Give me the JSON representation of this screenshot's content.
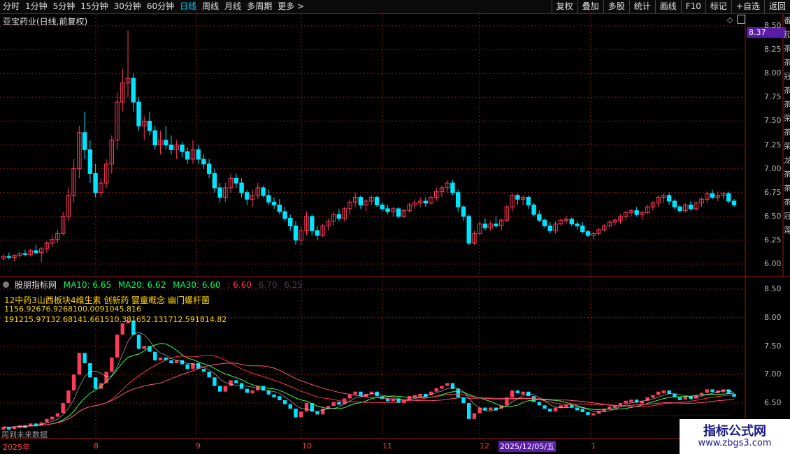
{
  "toolbar": {
    "periods": [
      "分时",
      "1分钟",
      "5分钟",
      "15分钟",
      "30分钟",
      "60分钟",
      "日线",
      "周线",
      "月线",
      "多周期",
      "更多"
    ],
    "active_index": 6,
    "tools": [
      "复权",
      "叠加",
      "多股",
      "统计",
      "画线",
      "F10",
      "标记",
      "+自选",
      "返回"
    ]
  },
  "stock": {
    "title": "亚宝药业(日线,前复权)",
    "last_price": "8.37"
  },
  "indicator": {
    "name": "股朋指标网",
    "ma10": "MA10: 6.65",
    "ma20": "MA20: 6.62",
    "ma30": "MA30: 6.60",
    "extra1": ": 6.60",
    "extra2": "6.70",
    "extra3": "6.25",
    "concepts": "12中药3山西板块4维生素 创新药 婴童概念 幽门螺杆菌",
    "line_a": "1156.92676.9268100.0091045.816",
    "line_b": "191215.97132.68141.661510.381652.131712.591814.82",
    "future_label": "周到未来数据"
  },
  "x_axis": {
    "labels": [
      "2025年",
      "8",
      "9",
      "10",
      "11",
      "12",
      "2025/12/05/五",
      "1"
    ]
  },
  "watermark": {
    "title": "指标公式网",
    "url": "www.zbgs3.com"
  },
  "colors": {
    "up": "#ff3b5c",
    "down": "#00e5ff",
    "ma10": "#ffffff",
    "ma20": "#ffd24a",
    "ma30": "#ff44cc",
    "grid": "#8a1a1a"
  },
  "chart_data": {
    "type": "candlestick",
    "y_axis_top": [
      6.0,
      6.25,
      6.5,
      6.75,
      7.0,
      7.25,
      7.5,
      7.75,
      8.0,
      8.25,
      8.5
    ],
    "y_axis_bottom": [
      6.5,
      7.0,
      7.5,
      8.0,
      8.5
    ],
    "ohlc": [
      [
        6.06,
        6.1,
        6.04,
        6.08
      ],
      [
        6.08,
        6.12,
        6.05,
        6.07
      ],
      [
        6.07,
        6.1,
        6.03,
        6.09
      ],
      [
        6.09,
        6.13,
        6.06,
        6.11
      ],
      [
        6.11,
        6.15,
        6.08,
        6.1
      ],
      [
        6.1,
        6.16,
        6.08,
        6.14
      ],
      [
        6.14,
        6.2,
        6.1,
        6.12
      ],
      [
        6.12,
        6.18,
        6.02,
        6.16
      ],
      [
        6.16,
        6.24,
        6.12,
        6.22
      ],
      [
        6.22,
        6.3,
        6.18,
        6.26
      ],
      [
        6.26,
        6.36,
        6.22,
        6.32
      ],
      [
        6.32,
        6.55,
        6.3,
        6.5
      ],
      [
        6.5,
        6.8,
        6.45,
        6.72
      ],
      [
        6.72,
        7.1,
        6.65,
        7.0
      ],
      [
        7.0,
        7.45,
        6.9,
        7.38
      ],
      [
        7.38,
        7.6,
        7.1,
        7.2
      ],
      [
        7.2,
        7.3,
        6.85,
        6.95
      ],
      [
        6.95,
        7.05,
        6.7,
        6.75
      ],
      [
        6.75,
        6.9,
        6.7,
        6.85
      ],
      [
        6.85,
        7.1,
        6.8,
        7.05
      ],
      [
        7.05,
        7.35,
        6.95,
        7.3
      ],
      [
        7.3,
        7.8,
        7.2,
        7.7
      ],
      [
        7.7,
        8.05,
        7.6,
        7.9
      ],
      [
        7.9,
        8.45,
        7.75,
        7.95
      ],
      [
        7.95,
        8.0,
        7.6,
        7.7
      ],
      [
        7.7,
        7.75,
        7.4,
        7.45
      ],
      [
        7.45,
        7.55,
        7.3,
        7.5
      ],
      [
        7.5,
        7.6,
        7.35,
        7.4
      ],
      [
        7.4,
        7.45,
        7.2,
        7.25
      ],
      [
        7.25,
        7.4,
        7.15,
        7.3
      ],
      [
        7.3,
        7.45,
        7.2,
        7.25
      ],
      [
        7.25,
        7.35,
        7.15,
        7.2
      ],
      [
        7.2,
        7.3,
        7.1,
        7.25
      ],
      [
        7.25,
        7.28,
        7.12,
        7.18
      ],
      [
        7.18,
        7.22,
        7.05,
        7.1
      ],
      [
        7.1,
        7.3,
        7.05,
        7.2
      ],
      [
        7.2,
        7.25,
        7.05,
        7.1
      ],
      [
        7.1,
        7.15,
        7.0,
        7.05
      ],
      [
        7.05,
        7.1,
        6.9,
        6.95
      ],
      [
        6.95,
        7.0,
        6.75,
        6.8
      ],
      [
        6.8,
        6.85,
        6.65,
        6.7
      ],
      [
        6.7,
        6.85,
        6.65,
        6.8
      ],
      [
        6.8,
        6.95,
        6.75,
        6.9
      ],
      [
        6.9,
        6.95,
        6.8,
        6.85
      ],
      [
        6.85,
        6.9,
        6.7,
        6.75
      ],
      [
        6.75,
        6.78,
        6.62,
        6.68
      ],
      [
        6.68,
        6.78,
        6.6,
        6.72
      ],
      [
        6.72,
        6.85,
        6.68,
        6.8
      ],
      [
        6.8,
        6.82,
        6.7,
        6.72
      ],
      [
        6.72,
        6.78,
        6.62,
        6.65
      ],
      [
        6.65,
        6.7,
        6.58,
        6.62
      ],
      [
        6.62,
        6.68,
        6.52,
        6.55
      ],
      [
        6.55,
        6.6,
        6.45,
        6.48
      ],
      [
        6.48,
        6.52,
        6.35,
        6.4
      ],
      [
        6.4,
        6.45,
        6.2,
        6.25
      ],
      [
        6.25,
        6.4,
        6.2,
        6.35
      ],
      [
        6.35,
        6.55,
        6.3,
        6.5
      ],
      [
        6.5,
        6.52,
        6.3,
        6.35
      ],
      [
        6.35,
        6.4,
        6.25,
        6.3
      ],
      [
        6.3,
        6.42,
        6.28,
        6.4
      ],
      [
        6.4,
        6.48,
        6.35,
        6.45
      ],
      [
        6.45,
        6.55,
        6.4,
        6.52
      ],
      [
        6.52,
        6.58,
        6.45,
        6.48
      ],
      [
        6.48,
        6.6,
        6.45,
        6.58
      ],
      [
        6.58,
        6.68,
        6.52,
        6.65
      ],
      [
        6.65,
        6.75,
        6.6,
        6.7
      ],
      [
        6.7,
        6.72,
        6.58,
        6.62
      ],
      [
        6.62,
        6.68,
        6.55,
        6.66
      ],
      [
        6.66,
        6.72,
        6.62,
        6.7
      ],
      [
        6.7,
        6.72,
        6.6,
        6.62
      ],
      [
        6.62,
        6.65,
        6.55,
        6.58
      ],
      [
        6.58,
        6.62,
        6.52,
        6.55
      ],
      [
        6.55,
        6.6,
        6.5,
        6.58
      ],
      [
        6.58,
        6.6,
        6.48,
        6.5
      ],
      [
        6.5,
        6.58,
        6.48,
        6.56
      ],
      [
        6.56,
        6.64,
        6.54,
        6.62
      ],
      [
        6.62,
        6.68,
        6.58,
        6.64
      ],
      [
        6.64,
        6.7,
        6.6,
        6.66
      ],
      [
        6.66,
        6.7,
        6.6,
        6.64
      ],
      [
        6.64,
        6.72,
        6.62,
        6.7
      ],
      [
        6.7,
        6.8,
        6.66,
        6.76
      ],
      [
        6.76,
        6.82,
        6.7,
        6.8
      ],
      [
        6.8,
        6.88,
        6.75,
        6.85
      ],
      [
        6.85,
        6.88,
        6.72,
        6.75
      ],
      [
        6.75,
        6.78,
        6.55,
        6.6
      ],
      [
        6.6,
        6.62,
        6.45,
        6.5
      ],
      [
        6.5,
        6.52,
        6.2,
        6.22
      ],
      [
        6.22,
        6.35,
        6.2,
        6.32
      ],
      [
        6.32,
        6.45,
        6.3,
        6.42
      ],
      [
        6.42,
        6.48,
        6.35,
        6.38
      ],
      [
        6.38,
        6.45,
        6.35,
        6.42
      ],
      [
        6.42,
        6.5,
        6.38,
        6.4
      ],
      [
        6.4,
        6.48,
        6.35,
        6.46
      ],
      [
        6.46,
        6.62,
        6.44,
        6.6
      ],
      [
        6.6,
        6.75,
        6.55,
        6.72
      ],
      [
        6.72,
        6.74,
        6.62,
        6.68
      ],
      [
        6.68,
        6.72,
        6.62,
        6.7
      ],
      [
        6.7,
        6.72,
        6.58,
        6.62
      ],
      [
        6.62,
        6.64,
        6.5,
        6.52
      ],
      [
        6.52,
        6.56,
        6.44,
        6.46
      ],
      [
        6.46,
        6.48,
        6.38,
        6.4
      ],
      [
        6.4,
        6.44,
        6.32,
        6.35
      ],
      [
        6.35,
        6.45,
        6.32,
        6.42
      ],
      [
        6.42,
        6.48,
        6.4,
        6.46
      ],
      [
        6.46,
        6.5,
        6.42,
        6.47
      ],
      [
        6.47,
        6.49,
        6.4,
        6.42
      ],
      [
        6.42,
        6.45,
        6.36,
        6.4
      ],
      [
        6.4,
        6.44,
        6.32,
        6.34
      ],
      [
        6.34,
        6.36,
        6.28,
        6.3
      ],
      [
        6.3,
        6.34,
        6.26,
        6.32
      ],
      [
        6.32,
        6.38,
        6.3,
        6.36
      ],
      [
        6.36,
        6.42,
        6.34,
        6.4
      ],
      [
        6.4,
        6.46,
        6.38,
        6.44
      ],
      [
        6.44,
        6.48,
        6.4,
        6.46
      ],
      [
        6.46,
        6.52,
        6.42,
        6.5
      ],
      [
        6.5,
        6.56,
        6.46,
        6.54
      ],
      [
        6.54,
        6.58,
        6.5,
        6.56
      ],
      [
        6.56,
        6.6,
        6.5,
        6.52
      ],
      [
        6.52,
        6.56,
        6.46,
        6.54
      ],
      [
        6.54,
        6.62,
        6.52,
        6.6
      ],
      [
        6.6,
        6.66,
        6.56,
        6.64
      ],
      [
        6.64,
        6.72,
        6.6,
        6.7
      ],
      [
        6.7,
        6.74,
        6.64,
        6.72
      ],
      [
        6.72,
        6.75,
        6.62,
        6.66
      ],
      [
        6.66,
        6.68,
        6.58,
        6.6
      ],
      [
        6.6,
        6.62,
        6.54,
        6.56
      ],
      [
        6.56,
        6.64,
        6.54,
        6.62
      ],
      [
        6.62,
        6.66,
        6.56,
        6.58
      ],
      [
        6.58,
        6.66,
        6.56,
        6.64
      ],
      [
        6.64,
        6.7,
        6.6,
        6.68
      ],
      [
        6.68,
        6.76,
        6.64,
        6.74
      ],
      [
        6.74,
        6.78,
        6.68,
        6.7
      ],
      [
        6.7,
        6.76,
        6.66,
        6.72
      ],
      [
        6.72,
        6.76,
        6.68,
        6.74
      ],
      [
        6.74,
        6.76,
        6.64,
        6.66
      ],
      [
        6.66,
        6.68,
        6.6,
        6.62
      ]
    ]
  }
}
